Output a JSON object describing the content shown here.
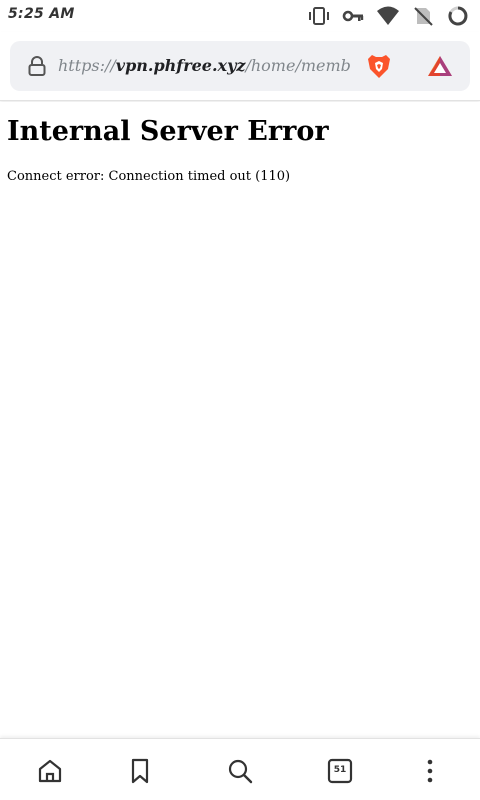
{
  "status_bar": {
    "time": "5:25 AM",
    "icons": [
      "vibrate-icon",
      "vpn-key-icon",
      "wifi-icon",
      "no-sim-icon",
      "loading-ring-icon"
    ]
  },
  "toolbar": {
    "url": {
      "scheme": "https://",
      "host": "vpn.phfree.xyz",
      "path": "/home/memb"
    },
    "icons": [
      "lock-icon",
      "brave-shields-icon",
      "brave-rewards-icon"
    ],
    "colors": {
      "url_bar_bg": "#f0f1f4",
      "brave_orange": "#fb542b",
      "rewards_red": "#e2442e"
    }
  },
  "page": {
    "heading": "Internal Server Error",
    "message": "Connect error: Connection timed out (110)"
  },
  "bottom_nav": {
    "items": [
      {
        "name": "home",
        "icon": "home-icon"
      },
      {
        "name": "bookmarks",
        "icon": "bookmark-icon"
      },
      {
        "name": "search",
        "icon": "search-icon"
      },
      {
        "name": "tabs",
        "icon": "tabs-icon",
        "count": "51"
      },
      {
        "name": "menu",
        "icon": "more-vertical-icon"
      }
    ]
  }
}
